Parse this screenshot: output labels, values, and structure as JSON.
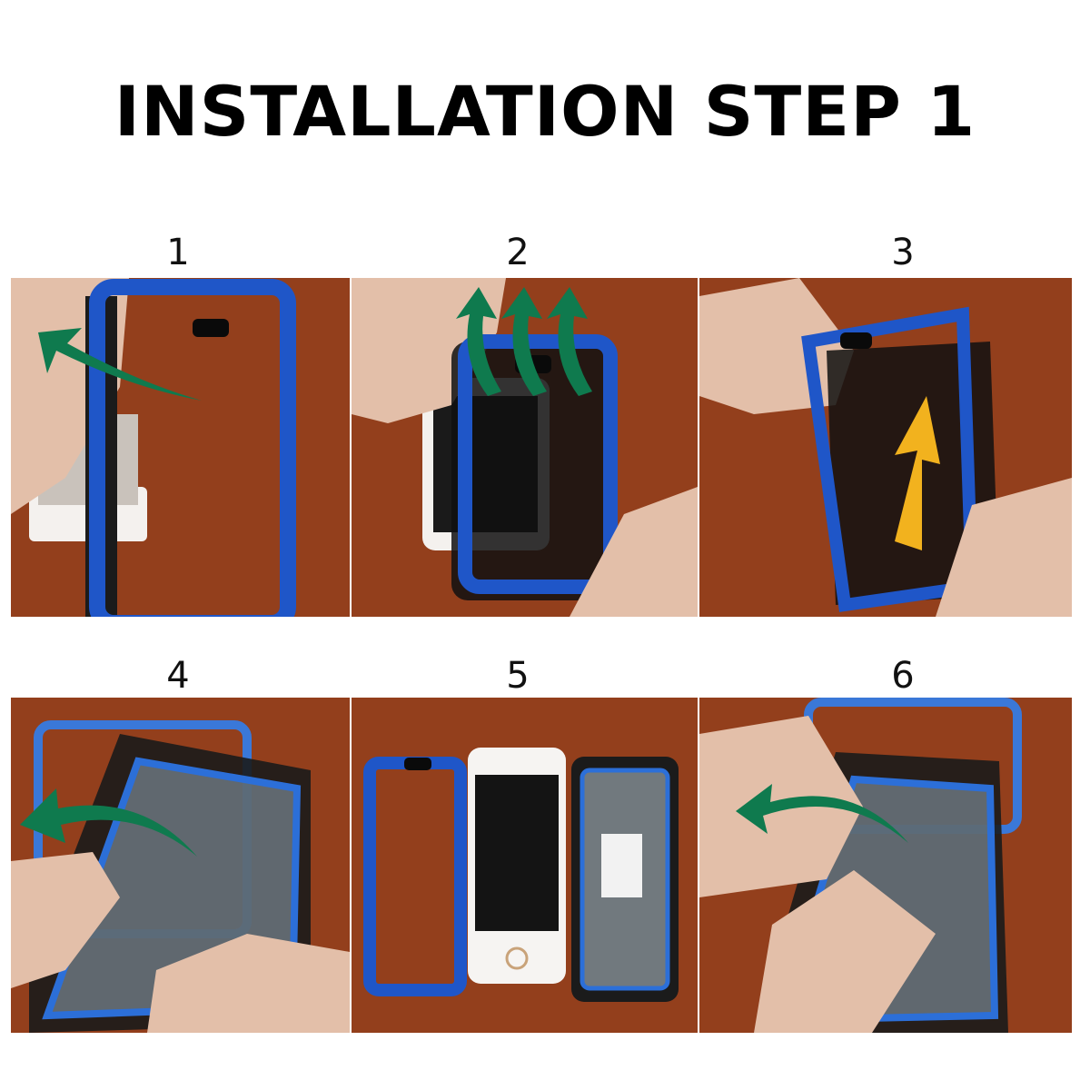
{
  "title": "INSTALLATION STEP 1",
  "steps": [
    {
      "number": "1"
    },
    {
      "number": "2"
    },
    {
      "number": "3"
    },
    {
      "number": "4"
    },
    {
      "number": "5"
    },
    {
      "number": "6"
    }
  ],
  "colors": {
    "table": "#8a3a1a",
    "case_blue": "#1f56c8",
    "case_black": "#1b1b1b",
    "arrow_green": "#0f7a4e",
    "arrow_yellow": "#f2b21e",
    "skin": "#e6c1ab"
  }
}
